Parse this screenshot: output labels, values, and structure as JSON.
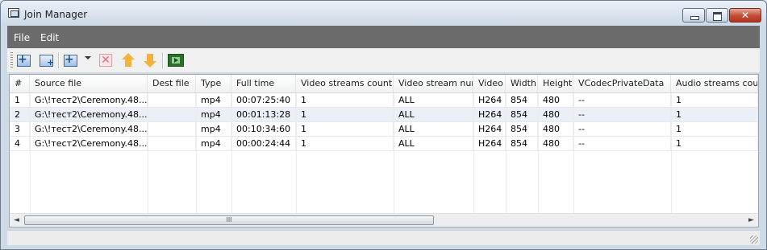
{
  "window": {
    "title": "Join Manager"
  },
  "menu": {
    "items": [
      "File",
      "Edit"
    ]
  },
  "toolbar": {
    "buttons": [
      {
        "name": "add-file-icon"
      },
      {
        "name": "add-folder-icon"
      },
      {
        "name": "add-with-options-icon"
      },
      {
        "name": "delete-icon"
      },
      {
        "name": "move-up-icon"
      },
      {
        "name": "move-down-icon"
      },
      {
        "name": "join-run-icon"
      }
    ]
  },
  "table": {
    "columns": [
      "#",
      "Source file",
      "Dest file",
      "Type",
      "Full time",
      "Video streams count",
      "Video stream num",
      "Video",
      "Width",
      "Height",
      "VCodecPrivateData",
      "Audio streams count"
    ],
    "rows": [
      [
        "1",
        "G:\\!тест2\\Ceremony.48...",
        "",
        "mp4",
        "00:07:25:40",
        "1",
        "ALL",
        "H264",
        "854",
        "480",
        "--",
        "1"
      ],
      [
        "2",
        "G:\\!тест2\\Ceremony.48...",
        "",
        "mp4",
        "00:01:13:28",
        "1",
        "ALL",
        "H264",
        "854",
        "480",
        "--",
        "1"
      ],
      [
        "3",
        "G:\\!тест2\\Ceremony.48...",
        "",
        "mp4",
        "00:10:34:60",
        "1",
        "ALL",
        "H264",
        "854",
        "480",
        "--",
        "1"
      ],
      [
        "4",
        "G:\\!тест2\\Ceremony.48...",
        "",
        "mp4",
        "00:00:24:44",
        "1",
        "ALL",
        "H264",
        "854",
        "480",
        "--",
        "1"
      ]
    ],
    "selected_row": 1
  },
  "scrollbar": {
    "left_arrow": "◄",
    "right_arrow": "►",
    "thumb_grip": "III"
  },
  "colors": {
    "menubar": "#6b6b6b",
    "selection": "#ebf0f8",
    "close_button": "#c24b35"
  }
}
